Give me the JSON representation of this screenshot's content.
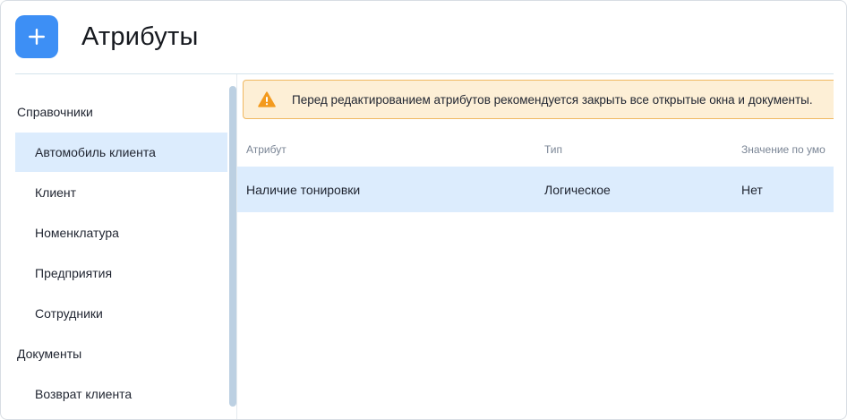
{
  "header": {
    "title": "Атрибуты",
    "add_icon": "plus-icon"
  },
  "sidebar": {
    "sections": [
      {
        "label": "Справочники"
      },
      {
        "label": "Документы"
      }
    ],
    "items": [
      {
        "label": "Автомобиль клиента",
        "active": true
      },
      {
        "label": "Клиент"
      },
      {
        "label": "Номенклатура"
      },
      {
        "label": "Предприятия"
      },
      {
        "label": "Сотрудники"
      },
      {
        "label": "Возврат клиента"
      }
    ]
  },
  "alert": {
    "icon": "warning-icon",
    "text": "Перед редактированием атрибутов рекомендуется закрыть все открытые окна и документы."
  },
  "table": {
    "columns": [
      "Атрибут",
      "Тип",
      "Значение по умо"
    ],
    "rows": [
      {
        "attribute": "Наличие тонировки",
        "type": "Логическое",
        "default": "Нет"
      }
    ]
  },
  "colors": {
    "accent": "#3d8ff5",
    "active_bg": "#dcecfd",
    "alert_bg": "#fdefd6",
    "alert_border": "#f0b862",
    "warning_icon": "#f39a1e"
  }
}
